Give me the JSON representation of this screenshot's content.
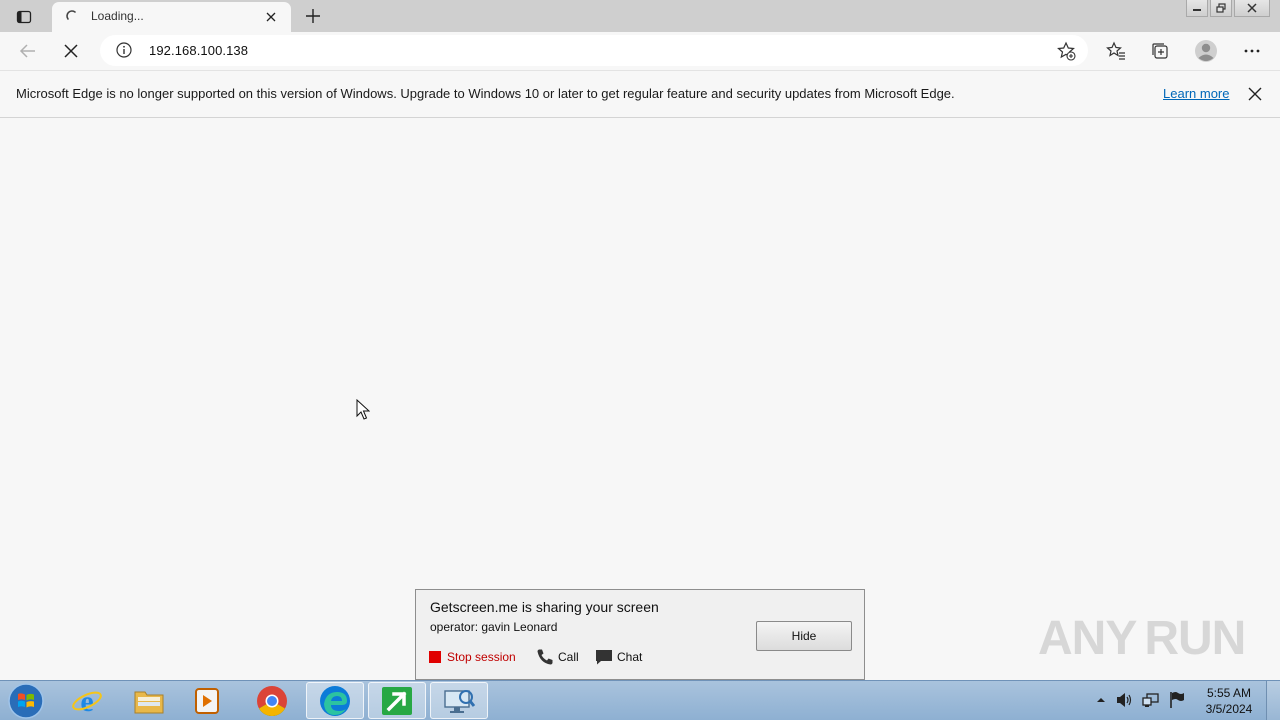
{
  "browser": {
    "tab": {
      "title": "Loading..."
    },
    "address": {
      "url": "192.168.100.138"
    }
  },
  "infobar": {
    "message": "Microsoft Edge is no longer supported on this version of Windows. Upgrade to Windows 10 or later to get regular feature and security updates from Microsoft Edge.",
    "link": "Learn more"
  },
  "getscreen": {
    "title": "Getscreen.me is sharing your screen",
    "operator": "operator: gavin Leonard",
    "stop_label": "Stop session",
    "call_label": "Call",
    "chat_label": "Chat",
    "hide_label": "Hide"
  },
  "watermark": {
    "text_left": "ANY",
    "text_right": "RUN"
  },
  "taskbar": {
    "apps": [
      "internet-explorer",
      "file-explorer",
      "media-player",
      "chrome",
      "edge",
      "getscreen",
      "remote-app"
    ],
    "time": "5:55 AM",
    "date": "3/5/2024"
  },
  "colors": {
    "accent_link": "#0067b8",
    "stop_red": "#e00000",
    "taskbar": "#a9c3dd"
  }
}
